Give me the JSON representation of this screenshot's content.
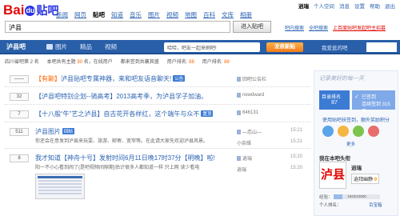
{
  "header": {
    "logo": {
      "left": "Bai",
      "paw": "du",
      "right": "贴吧"
    },
    "nav": [
      "新闻",
      "网页",
      "贴吧",
      "知道",
      "音乐",
      "图片",
      "视频",
      "地图",
      "百科",
      "文库",
      "相册"
    ],
    "user": {
      "name": "逍瑞",
      "menu": "个人空间",
      "message": "消息",
      "settings": "设置",
      "help": "帮助",
      "logout": "退出"
    }
  },
  "search": {
    "value": "泸县",
    "button": "进入贴吧",
    "links": {
      "create": "吧内搜索",
      "advanced": "全吧搜索",
      "hot": "上百度贴吧发起吧主招募"
    }
  },
  "forum": {
    "name": "泸县吧",
    "tabs": [
      "图片",
      "精品",
      "视频"
    ],
    "announcement": "哈哈，吧友一起来刷吧!",
    "post_button": "发表新贴",
    "other_label": "我爱逛的吧"
  },
  "stats": {
    "rank_label": "四川省吧第 2 名",
    "topics_label": "本吧共有主题",
    "topics": "90",
    "visitors_label": "名，在线用户",
    "members_label": "都来签到共襄其盛",
    "members_suffix": "位",
    "level_label": "用户排名",
    "level": "88",
    "growth_label": "用户排名",
    "growth": "88"
  },
  "threads": [
    {
      "count": "——",
      "tag": "【有聊】",
      "title": "泸县贴吧专属神器，来和吧友语音聊天!",
      "badge": "公告",
      "author": "回吧公告栏",
      "time": "",
      "excerpt": ""
    },
    {
      "count": "32",
      "tag": "",
      "title": "【泸县吧特别企划--骑高考】2013高考季，为泸县学子加油。",
      "badge": "",
      "author": "newdward",
      "time": "",
      "excerpt": ""
    },
    {
      "count": "7",
      "tag": "",
      "title": "【十八般“牛”艺之泸县】自古花开各样红，这个端午与众不",
      "badge": "置顶",
      "author": "646131",
      "time": "",
      "excerpt": ""
    },
    {
      "count": "511",
      "tag": "",
      "title": "泸县图片",
      "badge": "回帖",
      "author": "—恋山—",
      "time": "15:21",
      "excerpt": "你还会在意发到泸县来玩耍、旅游、邮寄、宽窄等。在此请大家先欢迎泸县风景。",
      "last_reply": "小奈维",
      "last_time": "15:21"
    },
    {
      "count": "8",
      "tag": "",
      "title": "我才知道【神舟十号】发射时间6月11日晚17时37分【明晚】啦!",
      "badge": "",
      "author": "逍瑞",
      "time": "15:20",
      "excerpt": "阳一不小心看到闹了(是吧视频间隙期)估计很多人都知道一样 只上网 读少看电",
      "last_reply": "逍瑞",
      "last_time": "15:20"
    }
  ],
  "sidebar": {
    "slogan": "记录美好的每一天",
    "sign_label": "目录排名",
    "sign_rank": "87",
    "signed_label": "已签到",
    "signed_days": "连续签到 315 天",
    "subscribe": "使用贴吧扶签到，额外奖励积分",
    "more": "更多",
    "myinfo_label": "我在本吧头衔",
    "avatar_text": "泸县",
    "user_name": "逍瑞",
    "level_label": "逍拜幽静",
    "level_num": "9",
    "exp_label": "经验：",
    "exp_value": "1923/10000",
    "exp_fraction": 0.19,
    "member_label": "个人排名：",
    "baidu_label": "百宝箱"
  },
  "colors": {
    "brand_blue": "#295fa8",
    "baidu_red": "#e10602",
    "link": "#2d64b3",
    "accent_orange": "#f37b17"
  }
}
